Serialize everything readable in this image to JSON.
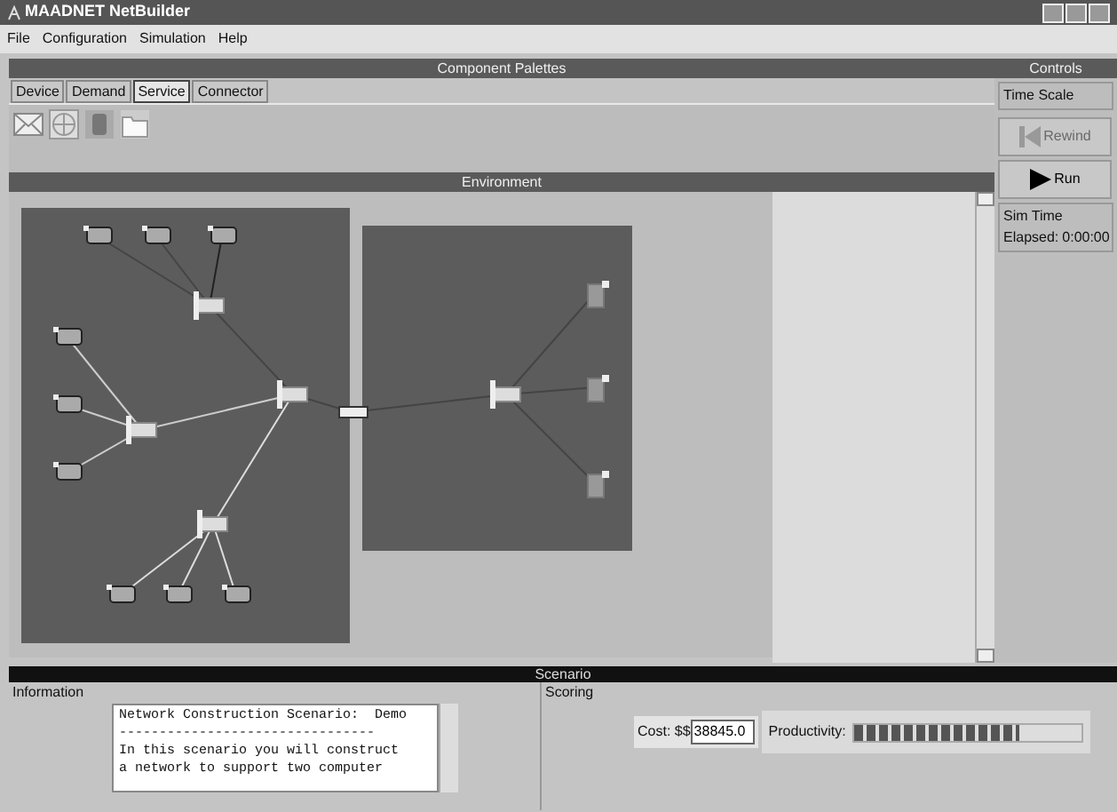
{
  "window": {
    "title": "MAADNET NetBuilder"
  },
  "menu": [
    "File",
    "Configuration",
    "Simulation",
    "Help"
  ],
  "palettes": {
    "title": "Component Palettes",
    "tabs": [
      {
        "label": "Device",
        "selected": false
      },
      {
        "label": "Demand",
        "selected": false
      },
      {
        "label": "Service",
        "selected": true
      },
      {
        "label": "Connector",
        "selected": false
      }
    ]
  },
  "environment": {
    "title": "Environment"
  },
  "controls": {
    "title": "Controls",
    "time_scale": "Time Scale",
    "buttons": [
      {
        "kind": "rewind",
        "label": "Rewind",
        "disabled": true
      },
      {
        "kind": "run",
        "label": "Run",
        "disabled": false
      }
    ],
    "sim_time": {
      "title": "Sim Time",
      "label": "Elapsed:",
      "value": "0:00:00"
    }
  },
  "scenario": {
    "title": "Scenario",
    "information": {
      "title": "Information",
      "lines": [
        "Network Construction Scenario:  Demo",
        "--------------------------------",
        "In this scenario you will construct",
        "a network to support two computer"
      ]
    },
    "scoring": {
      "title": "Scoring",
      "cost_label": "Cost: $$",
      "cost_value": "38845.0",
      "productivity_label": "Productivity:",
      "productivity": {
        "level": 0.72
      }
    }
  }
}
